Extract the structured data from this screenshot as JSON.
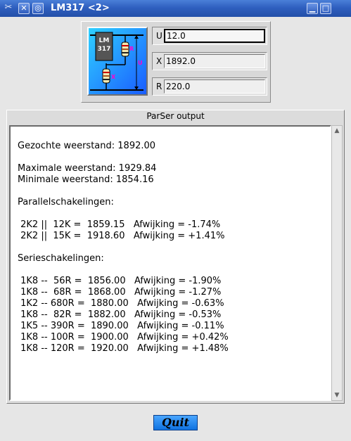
{
  "window": {
    "title": "LM317 <2>"
  },
  "logo": {
    "chip": "LM\n317",
    "r_label": "R",
    "x_label": "X",
    "u_label": "U"
  },
  "fields": [
    {
      "label": "U",
      "value": "12.0"
    },
    {
      "label": "X",
      "value": "1892.0"
    },
    {
      "label": "R",
      "value": "220.0"
    }
  ],
  "output": {
    "title": "ParSer output",
    "lines": [
      "Gezochte weerstand: 1892.00",
      "",
      "Maximale weerstand: 1929.84",
      "Minimale weerstand: 1854.16",
      "",
      "Parallelschakelingen:",
      "",
      " 2K2 ||  12K =  1859.15   Afwijking = -1.74%",
      " 2K2 ||  15K =  1918.60   Afwijking = +1.41%",
      "",
      "Serieschakelingen:",
      "",
      " 1K8 --  56R =  1856.00   Afwijking = -1.90%",
      " 1K8 --  68R =  1868.00   Afwijking = -1.27%",
      " 1K2 -- 680R =  1880.00   Afwijking = -0.63%",
      " 1K8 --  82R =  1882.00   Afwijking = -0.53%",
      " 1K5 -- 390R =  1890.00   Afwijking = -0.11%",
      " 1K8 -- 100R =  1900.00   Afwijking = +0.42%",
      " 1K8 -- 120R =  1920.00   Afwijking = +1.48%"
    ]
  },
  "quit_label": "Quit"
}
